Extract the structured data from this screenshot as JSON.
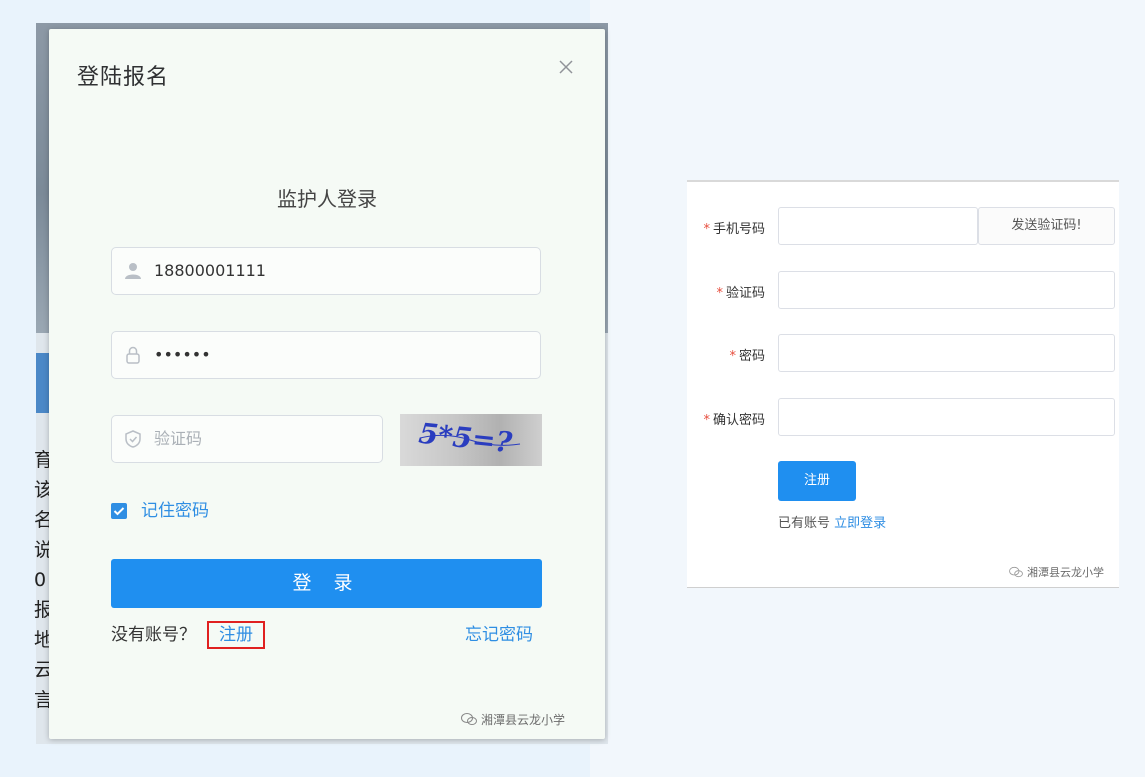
{
  "login_modal": {
    "title": "登陆报名",
    "heading": "监护人登录",
    "phone_value": "18800001111",
    "password_value": "••••••",
    "captcha_placeholder": "验证码",
    "captcha_image_text": "5*5=?",
    "remember_label": "记住密码",
    "remember_checked": true,
    "login_button": "登 录",
    "no_account_text": "没有账号？",
    "register_link": "注册",
    "forgot_link": "忘记密码",
    "watermark": "湘潭县云龙小学",
    "icons": [
      "close-icon",
      "user-icon",
      "lock-icon",
      "shield-icon",
      "checkbox-icon",
      "wechat-icon"
    ]
  },
  "background": {
    "side_chars": [
      "育",
      "该",
      "名",
      "说",
      "0",
      "报",
      "地",
      "云",
      "言"
    ]
  },
  "register_form": {
    "phone_label": "手机号码",
    "code_label": "验证码",
    "password_label": "密码",
    "confirm_label": "确认密码",
    "required_mark": "*",
    "send_code_button": "发送验证码!",
    "submit_button": "注册",
    "have_account_text": "已有账号",
    "login_now_link": "立即登录",
    "watermark": "湘潭县云龙小学"
  },
  "colors": {
    "primary": "#1f8ff0",
    "link": "#2f8ee3",
    "highlight_border": "#e02020",
    "required": "#e74c3c"
  }
}
